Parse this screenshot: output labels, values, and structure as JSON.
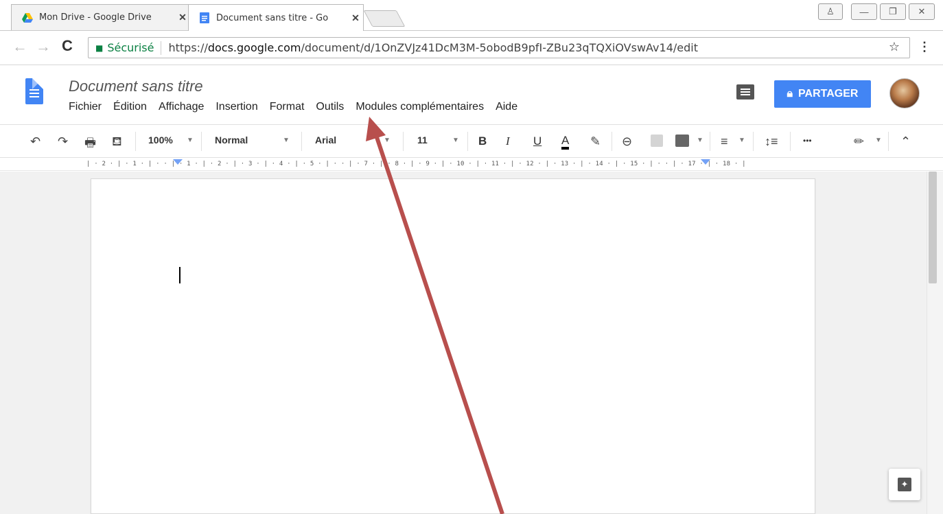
{
  "browser": {
    "tabs": [
      {
        "title": "Mon Drive - Google Drive",
        "active": false,
        "icon": "google-drive-icon"
      },
      {
        "title": "Document sans titre - Go",
        "active": true,
        "icon": "google-docs-icon"
      }
    ],
    "close_glyph": "✕",
    "window_buttons": {
      "user": "♙",
      "minimize": "—",
      "restore": "❐",
      "close": "✕"
    },
    "address": {
      "secure_label": "Sécurisé",
      "url_scheme": "https://",
      "url_host": "docs.google.com",
      "url_path": "/document/d/1OnZVJz41DcM3M-5obodB9pfI-ZBu23qTQXiOVswAv14/edit"
    }
  },
  "docs": {
    "title": "Document sans titre",
    "menu": [
      "Fichier",
      "Édition",
      "Affichage",
      "Insertion",
      "Format",
      "Outils",
      "Modules complémentaires",
      "Aide"
    ],
    "share_label": "PARTAGER",
    "share_icon": "lock-icon"
  },
  "toolbar": {
    "zoom": "100%",
    "style": "Normal",
    "font": "Arial",
    "size": "11",
    "bold": "B",
    "italic": "I",
    "underline": "U",
    "text_color": "A",
    "more": "•••"
  },
  "ruler": {
    "text": "| · 2 · | · 1 · | ·   · | · 1 · | · 2 · | · 3 · | · 4 · | · 5 · | ·   · | · 7 · | · 8 · | · 9 · | · 10 · | · 11 · | · 12 · | · 13 · | · 14 · | · 15 · | ·   · | · 17 · | · 18 · |"
  },
  "colors": {
    "accent": "#4285f4",
    "arrow": "#b84f4d",
    "secure": "#0b8043"
  }
}
